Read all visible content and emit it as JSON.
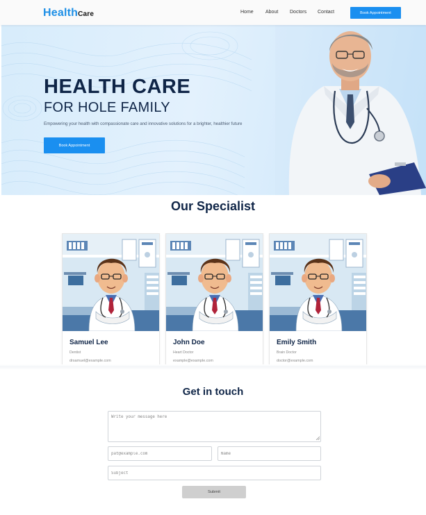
{
  "nav": {
    "logo_main": "Health",
    "logo_sub": "Care",
    "links": [
      "Home",
      "About",
      "Doctors",
      "Contact"
    ],
    "cta": "Book Appointment"
  },
  "hero": {
    "title": "HEALTH CARE",
    "subtitle": "FOR HOLE FAMILY",
    "description": "Empowering your health with compassionate care and innovative solutions for a brighter, healthier future",
    "button": "Book Appointment"
  },
  "specialists": {
    "title": "Our Specialist",
    "cards": [
      {
        "name": "Samuel Lee",
        "role": "Dentist",
        "email": "drsamuel@example.com"
      },
      {
        "name": "John Doe",
        "role": "Heart Doctor",
        "email": "example@example.com"
      },
      {
        "name": "Emily Smith",
        "role": "Brain Doctor",
        "email": "doctor@example.com"
      }
    ]
  },
  "contact": {
    "title": "Get in touch",
    "message_placeholder": "Write your message here",
    "email_placeholder": "pat@example.com",
    "name_placeholder": "Name",
    "subject_placeholder": "Subject",
    "submit": "Submit"
  },
  "colors": {
    "accent": "#1a8ff0",
    "heading": "#0f2547",
    "hero_bg": "#d7ecfb"
  }
}
